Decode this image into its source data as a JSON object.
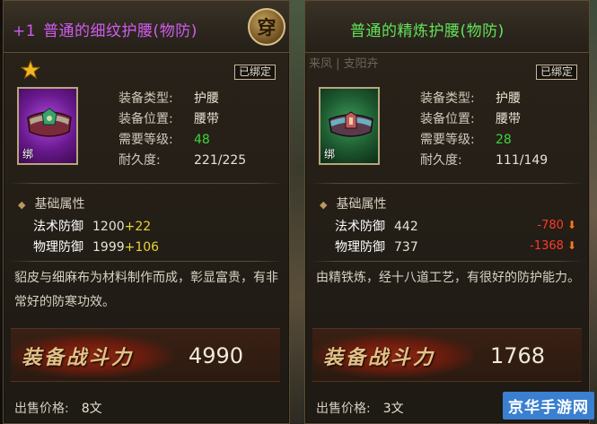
{
  "left_panel": {
    "plus_label": "+1",
    "title": "普通的细纹护腰(物防)",
    "equip_badge": "穿",
    "bound_tag": "已绑定",
    "icon_name": "waist-belt-icon",
    "bind_mark": "绑",
    "attributes": [
      {
        "label": "装备类型:",
        "value": "护腰"
      },
      {
        "label": "装备位置:",
        "value": "腰带"
      },
      {
        "label": "需要等级:",
        "value": "48"
      },
      {
        "label": "耐久度:",
        "value": "221/225"
      }
    ],
    "base_section_title": "基础属性",
    "base_stats": [
      {
        "label": "法术防御",
        "value": "1200",
        "bonus": "+22"
      },
      {
        "label": "物理防御",
        "value": "1999",
        "bonus": "+106"
      }
    ],
    "description": "貂皮与细麻布为材料制作而成，彰显富贵，有非常好的防寒功效。",
    "power_label": "装备战斗力",
    "power_value": "4990",
    "price_label": "出售价格:",
    "price_value": "8文"
  },
  "right_panel": {
    "title": "普通的精炼护腰(物防)",
    "header_strip": "来凤 | 支阳卉",
    "bound_tag": "已绑定",
    "icon_name": "waist-belt-icon",
    "bind_mark": "绑",
    "attributes": [
      {
        "label": "装备类型:",
        "value": "护腰"
      },
      {
        "label": "装备位置:",
        "value": "腰带"
      },
      {
        "label": "需要等级:",
        "value": "28"
      },
      {
        "label": "耐久度:",
        "value": "111/149"
      }
    ],
    "base_section_title": "基础属性",
    "base_stats": [
      {
        "label": "法术防御",
        "value": "442",
        "diff": "-780"
      },
      {
        "label": "物理防御",
        "value": "737",
        "diff": "-1368"
      }
    ],
    "description": "由精铁炼，经十八道工艺，有很好的防护能力。",
    "power_label": "装备战斗力",
    "power_value": "1768",
    "price_label": "出售价格:",
    "price_value": "3文"
  },
  "watermark": "京华手游网",
  "colors": {
    "purple_quality": "#cf5cf0",
    "green_quality": "#62e35a",
    "level_green": "#3fd43a",
    "bonus_yellow": "#e8d234",
    "diff_red": "#ff3a2a"
  }
}
